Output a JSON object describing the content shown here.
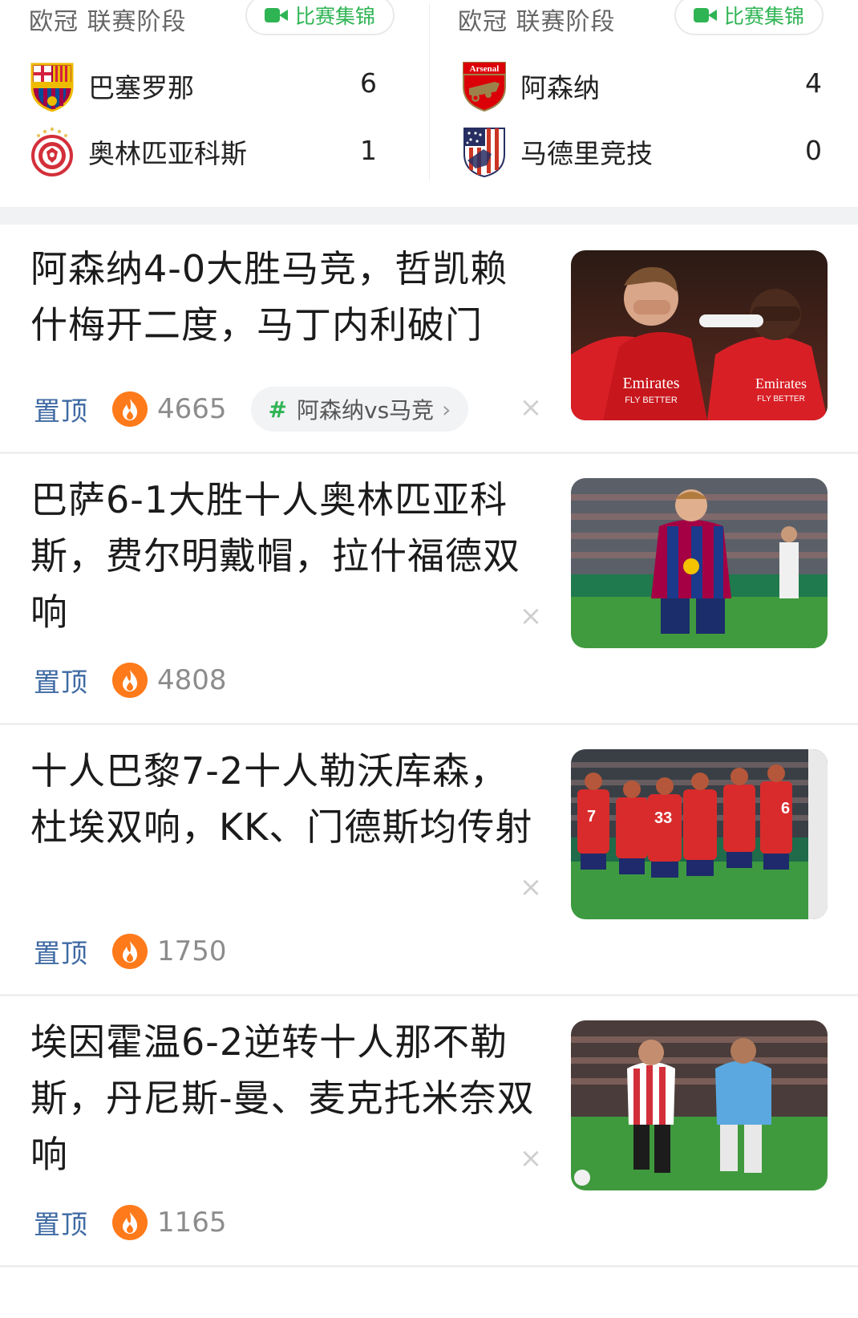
{
  "matches": [
    {
      "league": "欧冠 联赛阶段",
      "highlight_label": "比赛集锦",
      "teams": [
        {
          "name": "巴塞罗那",
          "score": "6",
          "logo": "fc-barcelona-crest"
        },
        {
          "name": "奥林匹亚科斯",
          "score": "1",
          "logo": "olympiacos-crest"
        }
      ]
    },
    {
      "league": "欧冠 联赛阶段",
      "highlight_label": "比赛集锦",
      "teams": [
        {
          "name": "阿森纳",
          "score": "4",
          "logo": "arsenal-crest",
          "crest_text": "Arsenal"
        },
        {
          "name": "马德里竞技",
          "score": "0",
          "logo": "atletico-madrid-crest"
        }
      ]
    }
  ],
  "news": [
    {
      "title": "阿森纳4-0大胜马竞，哲凯赖什梅开二度，马丁内利破门",
      "pin_label": "置顶",
      "hot_count": "4665",
      "topic": "阿森纳vs马竞",
      "thumb_text": [
        "Emirates",
        "FLY BETTER"
      ],
      "close_icon": "close-icon"
    },
    {
      "title": "巴萨6-1大胜十人奥林匹亚科斯，费尔明戴帽，拉什福德双响",
      "pin_label": "置顶",
      "hot_count": "4808",
      "close_icon": "close-icon"
    },
    {
      "title": "十人巴黎7-2十人勒沃库森，杜埃双响，KK、门德斯均传射",
      "pin_label": "置顶",
      "hot_count": "1750",
      "close_icon": "close-icon"
    },
    {
      "title": "埃因霍温6-2逆转十人那不勒斯，丹尼斯-曼、麦克托米奈双响",
      "pin_label": "置顶",
      "hot_count": "1165",
      "close_icon": "close-icon"
    }
  ],
  "colors": {
    "accent_green": "#2fb454",
    "pin_blue": "#3f6aa3",
    "hot_orange": "#ff7a1a",
    "divider": "#f1f2f4"
  }
}
